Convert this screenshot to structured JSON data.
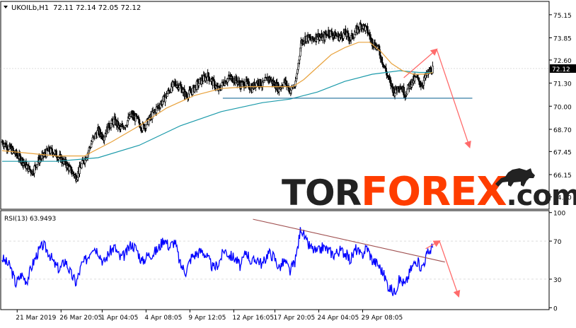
{
  "chart_data": [
    {
      "type": "candlestick",
      "header": {
        "symbol": "UKOILb,H1",
        "ohlc": "72.11 72.14 72.05 72.12"
      },
      "current_price": 72.12,
      "ylim": [
        64.2,
        75.9
      ],
      "yticks": [
        {
          "label": "75.15",
          "value": 75.15
        },
        {
          "label": "73.85",
          "value": 73.85
        },
        {
          "label": "72.60",
          "value": 72.6
        },
        {
          "label": "71.30",
          "value": 71.3
        },
        {
          "label": "70.00",
          "value": 70.0
        },
        {
          "label": "68.70",
          "value": 68.7
        },
        {
          "label": "67.45",
          "value": 67.45
        },
        {
          "label": "66.15",
          "value": 66.15
        },
        {
          "label": "64.90",
          "value": 64.9
        }
      ],
      "support_level": 70.45,
      "close_path": [
        [
          0,
          68.0
        ],
        [
          3,
          67.6
        ],
        [
          5,
          67.3
        ],
        [
          7,
          67.0
        ],
        [
          9,
          66.6
        ],
        [
          11,
          66.3
        ],
        [
          13,
          66.9
        ],
        [
          15,
          67.2
        ],
        [
          17,
          67.5
        ],
        [
          19,
          67.4
        ],
        [
          21,
          67.1
        ],
        [
          23,
          66.8
        ],
        [
          25,
          66.4
        ],
        [
          27,
          66.0
        ],
        [
          29,
          66.7
        ],
        [
          31,
          67.3
        ],
        [
          33,
          68.1
        ],
        [
          35,
          68.6
        ],
        [
          37,
          68.3
        ],
        [
          39,
          68.9
        ],
        [
          41,
          69.2
        ],
        [
          43,
          68.7
        ],
        [
          45,
          69.0
        ],
        [
          47,
          69.5
        ],
        [
          49,
          69.3
        ],
        [
          51,
          68.8
        ],
        [
          53,
          69.1
        ],
        [
          55,
          69.6
        ],
        [
          57,
          70.0
        ],
        [
          59,
          70.4
        ],
        [
          61,
          70.9
        ],
        [
          63,
          71.3
        ],
        [
          65,
          71.1
        ],
        [
          67,
          70.6
        ],
        [
          69,
          70.8
        ],
        [
          71,
          71.2
        ],
        [
          73,
          71.5
        ],
        [
          75,
          71.7
        ],
        [
          77,
          71.3
        ],
        [
          79,
          70.9
        ],
        [
          81,
          71.4
        ],
        [
          83,
          71.6
        ],
        [
          85,
          71.5
        ],
        [
          87,
          71.2
        ],
        [
          89,
          71.3
        ],
        [
          91,
          71.0
        ],
        [
          93,
          71.4
        ],
        [
          95,
          71.2
        ],
        [
          97,
          71.6
        ],
        [
          99,
          71.3
        ],
        [
          101,
          71.0
        ],
        [
          103,
          71.4
        ],
        [
          105,
          70.9
        ],
        [
          107,
          71.2
        ],
        [
          109,
          73.6
        ],
        [
          111,
          73.9
        ],
        [
          113,
          73.7
        ],
        [
          115,
          74.0
        ],
        [
          117,
          73.8
        ],
        [
          119,
          74.2
        ],
        [
          121,
          74.0
        ],
        [
          123,
          73.9
        ],
        [
          125,
          74.1
        ],
        [
          127,
          73.8
        ],
        [
          129,
          74.2
        ],
        [
          131,
          74.6
        ],
        [
          133,
          74.3
        ],
        [
          135,
          73.6
        ],
        [
          137,
          73.3
        ],
        [
          139,
          72.4
        ],
        [
          141,
          71.5
        ],
        [
          143,
          70.8
        ],
        [
          145,
          71.2
        ],
        [
          147,
          70.7
        ],
        [
          149,
          71.3
        ],
        [
          151,
          71.6
        ],
        [
          153,
          71.2
        ],
        [
          155,
          71.8
        ],
        [
          157,
          72.12
        ]
      ],
      "ma_fast_path": [
        [
          0,
          67.5
        ],
        [
          20,
          67.2
        ],
        [
          30,
          67.2
        ],
        [
          40,
          68.0
        ],
        [
          50,
          68.9
        ],
        [
          60,
          69.9
        ],
        [
          70,
          70.6
        ],
        [
          80,
          71.0
        ],
        [
          90,
          71.1
        ],
        [
          100,
          71.1
        ],
        [
          106,
          71.1
        ],
        [
          110,
          71.5
        ],
        [
          115,
          72.2
        ],
        [
          120,
          72.9
        ],
        [
          125,
          73.3
        ],
        [
          130,
          73.6
        ],
        [
          134,
          73.6
        ],
        [
          138,
          73.1
        ],
        [
          142,
          72.4
        ],
        [
          146,
          72.0
        ],
        [
          150,
          71.8
        ],
        [
          154,
          71.8
        ],
        [
          157,
          71.9
        ]
      ],
      "ma_slow_path": [
        [
          0,
          66.9
        ],
        [
          20,
          66.9
        ],
        [
          35,
          67.1
        ],
        [
          50,
          67.8
        ],
        [
          65,
          68.9
        ],
        [
          80,
          69.7
        ],
        [
          95,
          70.2
        ],
        [
          105,
          70.4
        ],
        [
          115,
          70.8
        ],
        [
          125,
          71.4
        ],
        [
          135,
          71.8
        ],
        [
          145,
          72.0
        ],
        [
          152,
          71.9
        ],
        [
          157,
          71.9
        ]
      ],
      "forecast_arrow": [
        [
          147,
          71.6
        ],
        [
          159,
          73.2
        ],
        [
          171,
          67.7
        ]
      ]
    },
    {
      "type": "line",
      "label": "RSI(13) 63.9493",
      "ylim": [
        -2,
        102
      ],
      "yticks": [
        {
          "label": "100",
          "value": 100
        },
        {
          "label": "70",
          "value": 70
        },
        {
          "label": "30",
          "value": 30
        },
        {
          "label": "0",
          "value": 0
        }
      ],
      "rsi_path": [
        [
          0,
          52
        ],
        [
          3,
          43
        ],
        [
          5,
          25
        ],
        [
          7,
          35
        ],
        [
          9,
          28
        ],
        [
          11,
          45
        ],
        [
          13,
          58
        ],
        [
          15,
          66
        ],
        [
          17,
          58
        ],
        [
          19,
          46
        ],
        [
          21,
          40
        ],
        [
          23,
          50
        ],
        [
          25,
          36
        ],
        [
          27,
          26
        ],
        [
          29,
          45
        ],
        [
          31,
          52
        ],
        [
          33,
          65
        ],
        [
          35,
          60
        ],
        [
          37,
          47
        ],
        [
          39,
          58
        ],
        [
          41,
          64
        ],
        [
          43,
          52
        ],
        [
          45,
          56
        ],
        [
          47,
          67
        ],
        [
          49,
          62
        ],
        [
          51,
          48
        ],
        [
          53,
          55
        ],
        [
          55,
          57
        ],
        [
          57,
          62
        ],
        [
          59,
          73
        ],
        [
          61,
          64
        ],
        [
          63,
          70
        ],
        [
          65,
          45
        ],
        [
          67,
          38
        ],
        [
          69,
          53
        ],
        [
          71,
          57
        ],
        [
          73,
          60
        ],
        [
          75,
          52
        ],
        [
          77,
          41
        ],
        [
          79,
          47
        ],
        [
          81,
          61
        ],
        [
          83,
          55
        ],
        [
          85,
          52
        ],
        [
          87,
          43
        ],
        [
          89,
          60
        ],
        [
          91,
          47
        ],
        [
          93,
          52
        ],
        [
          95,
          45
        ],
        [
          97,
          58
        ],
        [
          99,
          54
        ],
        [
          101,
          42
        ],
        [
          103,
          49
        ],
        [
          105,
          38
        ],
        [
          107,
          50
        ],
        [
          109,
          85
        ],
        [
          111,
          68
        ],
        [
          113,
          62
        ],
        [
          115,
          58
        ],
        [
          117,
          64
        ],
        [
          119,
          60
        ],
        [
          121,
          56
        ],
        [
          123,
          60
        ],
        [
          125,
          58
        ],
        [
          127,
          50
        ],
        [
          129,
          62
        ],
        [
          131,
          54
        ],
        [
          133,
          64
        ],
        [
          135,
          50
        ],
        [
          137,
          46
        ],
        [
          139,
          36
        ],
        [
          141,
          22
        ],
        [
          143,
          16
        ],
        [
          145,
          30
        ],
        [
          147,
          24
        ],
        [
          149,
          40
        ],
        [
          151,
          50
        ],
        [
          153,
          42
        ],
        [
          155,
          56
        ],
        [
          157,
          64
        ]
      ],
      "trendline": [
        [
          92,
          93
        ],
        [
          162,
          48
        ]
      ],
      "forecast_arrow": [
        [
          155,
          62
        ],
        [
          160,
          70
        ],
        [
          167,
          12
        ]
      ]
    }
  ],
  "x_axis_labels": [
    {
      "label": "21 Mar 2019",
      "index": 6
    },
    {
      "label": "26 Mar 20:05",
      "index": 22
    },
    {
      "label": "1 Apr 04:05",
      "index": 37
    },
    {
      "label": "4 Apr 08:05",
      "index": 53
    },
    {
      "label": "9 Apr 12:05",
      "index": 69
    },
    {
      "label": "12 Apr 16:05",
      "index": 85
    },
    {
      "label": "17 Apr 20:05",
      "index": 100
    },
    {
      "label": "24 Apr 04:05",
      "index": 116
    },
    {
      "label": "29 Apr 08:05",
      "index": 132
    }
  ],
  "x_count": 200,
  "colors": {
    "candle": "#000000",
    "ma_fast": "#e8a23c",
    "ma_slow": "#1b9aaa",
    "support": "#1f6f9a",
    "rsi": "#0000ff",
    "rsi_trend": "#a05050",
    "arrow": "#ff6b6b",
    "grid": "#c8c8c8",
    "price_tag": "#000000"
  },
  "watermark": {
    "part1": "TOR",
    "part2": "FOREX",
    "part3": ".com",
    "color1": "#222222",
    "color2": "#ff3d00",
    "color3": "#222222"
  }
}
